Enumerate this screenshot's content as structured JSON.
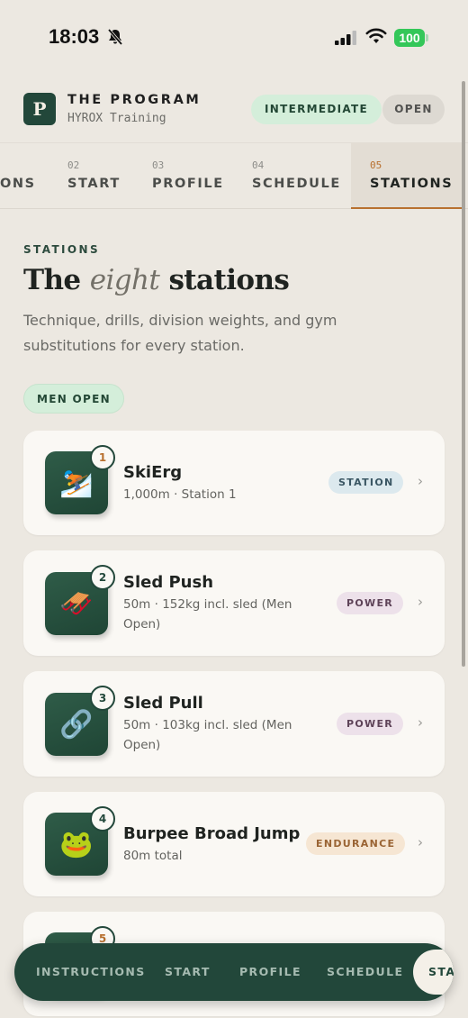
{
  "status": {
    "time": "18:03",
    "battery": "100"
  },
  "header": {
    "logo_letter": "P",
    "title": "THE PROGRAM",
    "subtitle": "HYROX Training",
    "level_pill": "INTERMEDIATE",
    "open_pill": "OPEN"
  },
  "tabs": [
    {
      "num": "",
      "label": "ONS"
    },
    {
      "num": "02",
      "label": "START"
    },
    {
      "num": "03",
      "label": "PROFILE"
    },
    {
      "num": "04",
      "label": "SCHEDULE"
    },
    {
      "num": "05",
      "label": "STATIONS",
      "active": true
    }
  ],
  "section": {
    "eyebrow": "STATIONS",
    "title_pre": "The ",
    "title_em": "eight",
    "title_post": " stations",
    "description": "Technique, drills, division weights, and gym substitutions for every station.",
    "division": "MEN OPEN"
  },
  "stations": [
    {
      "num": "1",
      "icon": "skier-icon",
      "emoji": "⛷️",
      "name": "SkiErg",
      "detail": "1,000m · Station 1",
      "tag": "STATION",
      "num_color": "#B8702F"
    },
    {
      "num": "2",
      "icon": "sled-icon",
      "emoji": "🛷",
      "name": "Sled Push",
      "detail": "50m · 152kg incl. sled (Men Open)",
      "tag": "POWER",
      "num_color": "#22473A"
    },
    {
      "num": "3",
      "icon": "chain-link-icon",
      "emoji": "🔗",
      "name": "Sled Pull",
      "detail": "50m · 103kg incl. sled (Men Open)",
      "tag": "POWER",
      "num_color": "#22473A"
    },
    {
      "num": "4",
      "icon": "frog-icon",
      "emoji": "🐸",
      "name": "Burpee Broad Jump",
      "detail": "80m total",
      "tag": "ENDURANCE",
      "num_color": "#22473A"
    },
    {
      "num": "5",
      "num_color": "#B8702F"
    }
  ],
  "bottom_nav": {
    "items": [
      "INSTRUCTIONS",
      "START",
      "PROFILE",
      "SCHEDULE"
    ],
    "active": "STATIONS"
  },
  "colors": {
    "background": "#ECE8E1",
    "brand_green": "#22473A",
    "accent_orange": "#B8702F",
    "card": "#FAF8F4"
  }
}
